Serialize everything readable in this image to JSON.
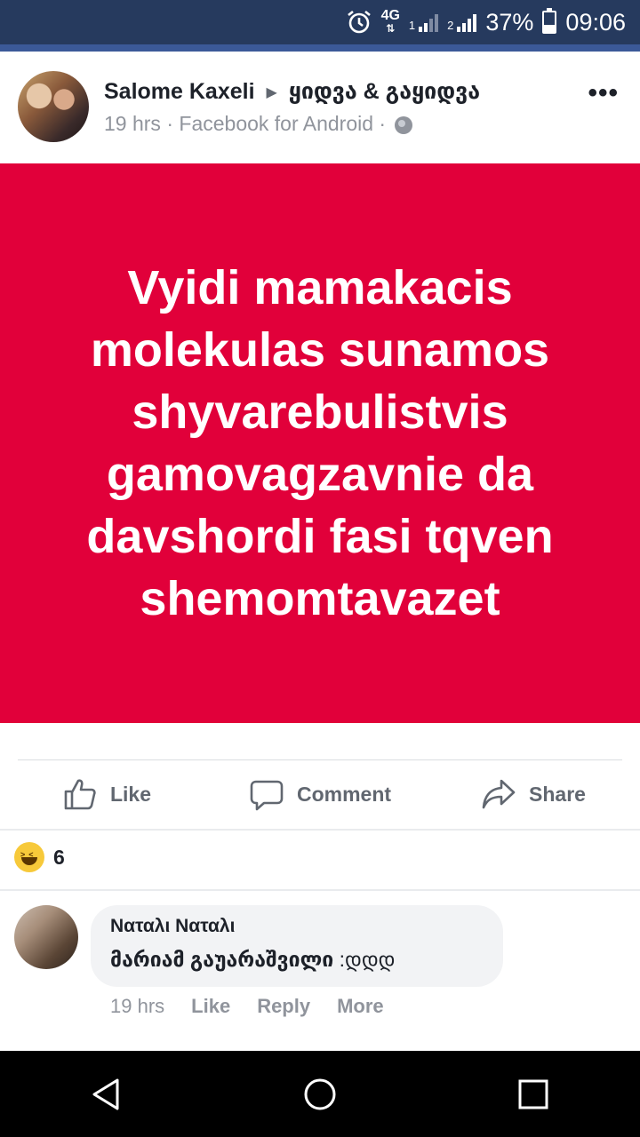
{
  "status_bar": {
    "network": "4G",
    "sim1": "1",
    "sim2": "2",
    "battery": "37%",
    "battery_level": 0.37,
    "time": "09:06"
  },
  "post": {
    "author": "Salome Kaxeli",
    "group": "ყიდვა & გაყიდვა",
    "time": "19 hrs",
    "source": "Facebook for Android",
    "meta_sep": "·",
    "more": "•••",
    "text": "Vyidi mamakacis molekulas sunamos shyvarebulistvis gamovagzavnie da davshordi fasi tqven shemomtavazet",
    "card_color": "#e1003a"
  },
  "actions": {
    "like": "Like",
    "comment": "Comment",
    "share": "Share"
  },
  "reactions": {
    "icon": "haha-icon",
    "count": "6"
  },
  "comment": {
    "author": "Ναταλι Ναταλι",
    "mention": "მარიამ გაუარაშვილი",
    "text": " :დდდ",
    "time": "19 hrs",
    "like": "Like",
    "reply": "Reply",
    "more": "More"
  }
}
